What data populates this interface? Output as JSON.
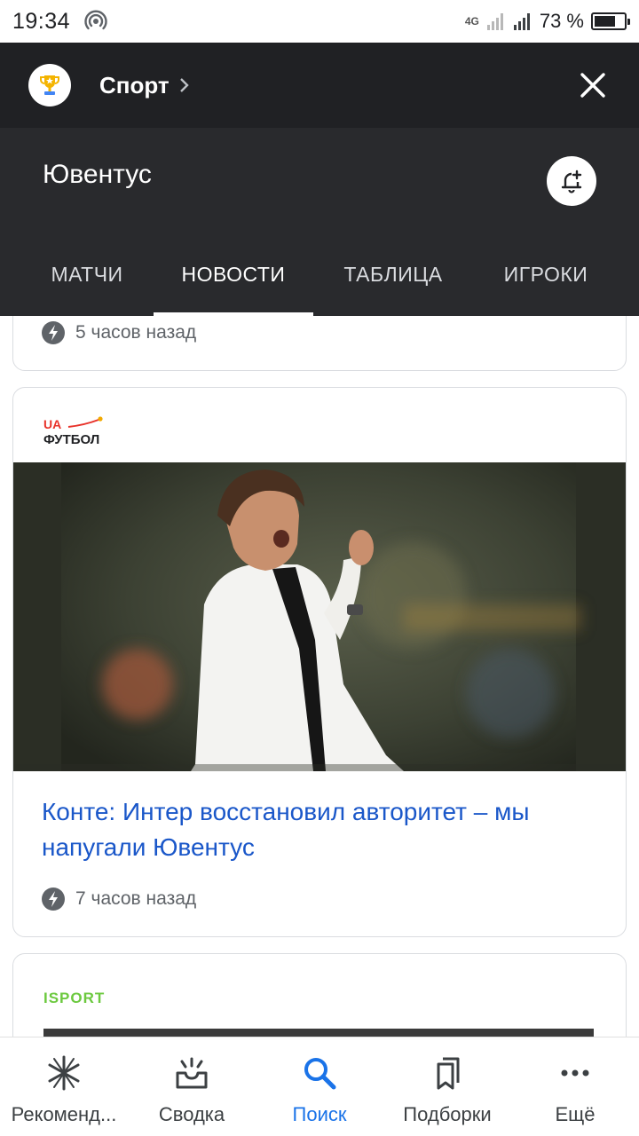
{
  "status_bar": {
    "time": "19:34",
    "network": "4G",
    "battery_percent_text": "73 %",
    "battery_level": 0.73
  },
  "top_bar": {
    "category_label": "Спорт",
    "category_icon": "trophy-icon",
    "close_icon": "close-icon"
  },
  "header": {
    "team_name": "Ювентус",
    "bell_icon": "bell-plus-icon"
  },
  "tabs": [
    {
      "label": "МАТЧИ",
      "active": false
    },
    {
      "label": "НОВОСТИ",
      "active": true
    },
    {
      "label": "ТАБЛИЦА",
      "active": false
    },
    {
      "label": "ИГРОКИ",
      "active": false
    }
  ],
  "feed": {
    "cards": [
      {
        "time_ago": "5 часов назад"
      },
      {
        "source": "UA ФУТБОЛ",
        "source_parts": [
          "UA",
          "ФУТБОЛ"
        ],
        "headline": "Конте: Интер восстановил авторитет – мы напугали Ювентус",
        "time_ago": "7 часов назад"
      },
      {
        "source": "ISPORT"
      }
    ]
  },
  "bottom_nav": [
    {
      "label": "Рекоменд...",
      "icon": "asterisk-icon",
      "active": false
    },
    {
      "label": "Сводка",
      "icon": "inbox-icon",
      "active": false
    },
    {
      "label": "Поиск",
      "icon": "search-icon",
      "active": true
    },
    {
      "label": "Подборки",
      "icon": "bookmarks-icon",
      "active": false
    },
    {
      "label": "Ещё",
      "icon": "more-icon",
      "active": false
    }
  ],
  "colors": {
    "top_bar_bg": "#202124",
    "header_bg": "#292a2d",
    "headline_link": "#1a57c9",
    "accent": "#1a73e8",
    "isport_green": "#6cc93f",
    "uafootball_red": "#e8322a"
  }
}
